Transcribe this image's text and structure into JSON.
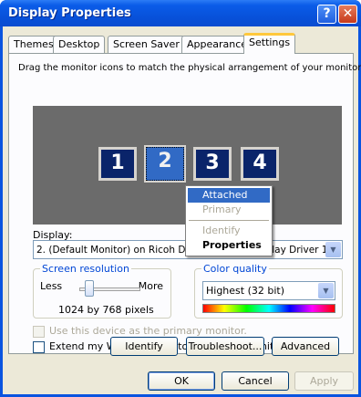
{
  "window": {
    "title": "Display Properties"
  },
  "tabs": [
    {
      "label": "Themes"
    },
    {
      "label": "Desktop"
    },
    {
      "label": "Screen Saver"
    },
    {
      "label": "Appearance"
    },
    {
      "label": "Settings"
    }
  ],
  "settings": {
    "instruction": "Drag the monitor icons to match the physical arrangement of your monitors.",
    "monitors": [
      {
        "label": "1"
      },
      {
        "label": "2"
      },
      {
        "label": "3"
      },
      {
        "label": "4"
      }
    ],
    "context_menu": {
      "items": [
        {
          "label": "Attached"
        },
        {
          "label": "Primary"
        },
        {
          "label": "Identify"
        },
        {
          "label": "Properties"
        }
      ]
    },
    "display_label": "Display:",
    "display_value": "2. (Default Monitor) on  Ricoh  DPJ Secondary Display Driver 1",
    "resolution": {
      "title": "Screen resolution",
      "less": "Less",
      "more": "More",
      "value_text": "1024 by 768 pixels",
      "level": 0.1
    },
    "color_quality": {
      "title": "Color quality",
      "value": "Highest (32 bit)"
    },
    "primary_checkbox": "Use this device as the primary monitor.",
    "extend_checkbox": "Extend my Windows desktop onto this monitor.",
    "buttons": {
      "identify": "Identify",
      "troubleshoot": "Troubleshoot...",
      "advanced": "Advanced"
    }
  },
  "footer": {
    "ok": "OK",
    "cancel": "Cancel",
    "apply": "Apply"
  },
  "icons": {
    "help": "question-mark-icon",
    "close": "close-icon",
    "dropdown": "chevron-down-icon"
  },
  "colors": {
    "titlebar": "#0a54e0",
    "selection": "#316ac5",
    "monitor": "#0a246a"
  }
}
